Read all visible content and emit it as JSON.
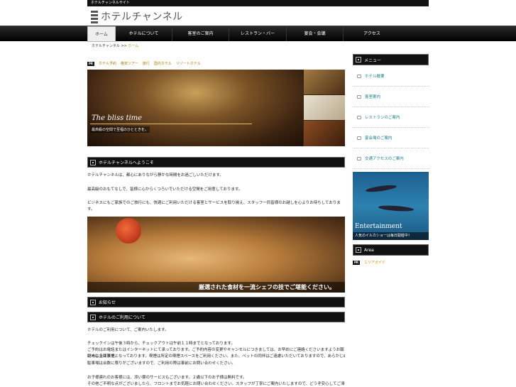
{
  "topbar": {
    "text": "ホテルチャンネルサイト"
  },
  "header": {
    "logo_text": "ホテルチャンネル"
  },
  "nav": {
    "items": [
      {
        "label": "ホーム",
        "active": true
      },
      {
        "label": "ホテルについて",
        "active": false
      },
      {
        "label": "客室のご案内",
        "active": false
      },
      {
        "label": "レストラン・バー",
        "active": false
      },
      {
        "label": "宴会・会議",
        "active": false
      },
      {
        "label": "アクセス",
        "active": false
      }
    ]
  },
  "breadcrumb": {
    "parent": "ホテルチャンネル",
    "separator": ">>",
    "current": "ホーム"
  },
  "pr_line": {
    "badge": "PR",
    "links": [
      "ホテル予約",
      "格安ツアー",
      "旅行",
      "国内ホテル",
      "リゾートホテル"
    ]
  },
  "hero": {
    "script_text": "The bliss time",
    "caption": "最高級の空間で至福のひとときを。"
  },
  "sections": {
    "intro": {
      "title": "ホテルチャンネルへようこそ",
      "paragraphs": [
        "ホテルチャンネルは、都心にありながら静かな時間をお過ごしいただけます。",
        "最高級のおもてなしで、皆様に心からくつろいでいただける空間をご用意しております。",
        "ビジネスにもご家族でのご旅行にも、快適にご利用いただける客室とサービスを取り揃え、スタッフ一同皆様のお越しを心よりお待ちしております。"
      ]
    },
    "food_caption": "厳選された食材を一流シェフの技でご堪能ください。",
    "news": {
      "title": "お知らせ"
    },
    "guide": {
      "title": "ホテルのご利用について",
      "lead": "ホテルのご利用について、ご案内いたします。",
      "paragraphs": [
        "チェックインは午後３時から、チェックアウトは午前１１時までとなっております。",
        "ご予約はお電話またはインターネットにて承っております。ご予約内容の変更やキャンセルにつきましては、お早めにご連絡くださいますようお願い申し上げます。",
        "館内は全面禁煙となっております。喫煙は所定の喫煙スペースをご利用ください。また、ペットの同伴はご遠慮いただいておりますので、あらかじめご了承ください。",
        "駐車場は台数に限りがございますので、ご利用の際は事前にお問い合わせください。",
        "お子様連れのお客様には、添い寝のサービスもございます。２歳以下のお子様は無料です。",
        "その他ご不明な点がございましたら、フロントまでお気軽にお問い合わせください。スタッフが丁寧にご案内いたしますので、どうぞ安心してご滞在をお楽しみください。"
      ]
    }
  },
  "sidebar": {
    "menu_title": "メニュー",
    "menu_items": [
      "ホテル概要",
      "客室案内",
      "レストランのご案内",
      "宴会場のご案内",
      "交通アクセスのご案内"
    ],
    "entertainment": {
      "label": "Entertainment",
      "caption": "人気のイルカショーは毎日開催中！"
    },
    "area_title": "Area",
    "area_badge": "PR",
    "area_link": "エリアガイド"
  }
}
